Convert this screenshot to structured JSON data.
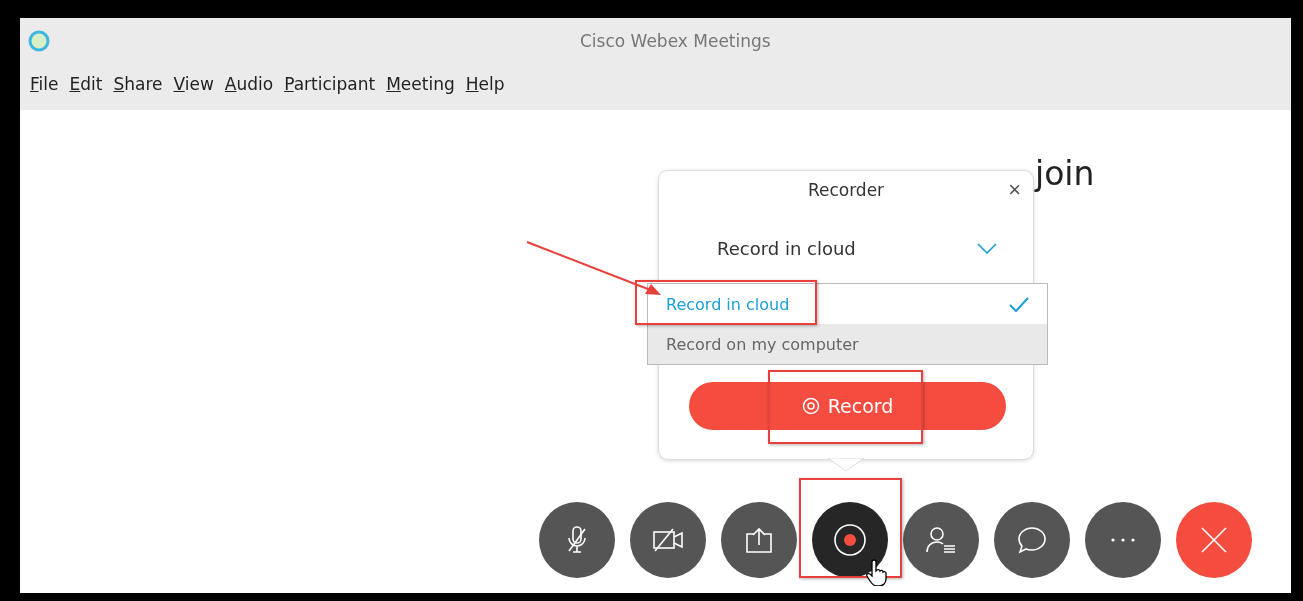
{
  "window": {
    "title": "Cisco Webex Meetings"
  },
  "menu": [
    {
      "label": "File"
    },
    {
      "label": "Edit"
    },
    {
      "label": "Share"
    },
    {
      "label": "View"
    },
    {
      "label": "Audio"
    },
    {
      "label": "Participant"
    },
    {
      "label": "Meeting"
    },
    {
      "label": "Help"
    }
  ],
  "heading": "join",
  "recorder": {
    "title": "Recorder",
    "close": "×",
    "select_value": "Record in cloud",
    "options": [
      {
        "label": "Record in cloud",
        "selected": true
      },
      {
        "label": "Record on my computer",
        "selected": false
      }
    ],
    "record_button": "Record"
  },
  "toolbar": [
    {
      "kind": "mute",
      "selected": false
    },
    {
      "kind": "video",
      "selected": false
    },
    {
      "kind": "share",
      "selected": false
    },
    {
      "kind": "record",
      "selected": true
    },
    {
      "kind": "participants",
      "selected": false
    },
    {
      "kind": "chat",
      "selected": false
    },
    {
      "kind": "more",
      "selected": false
    },
    {
      "kind": "end",
      "selected": false
    }
  ]
}
